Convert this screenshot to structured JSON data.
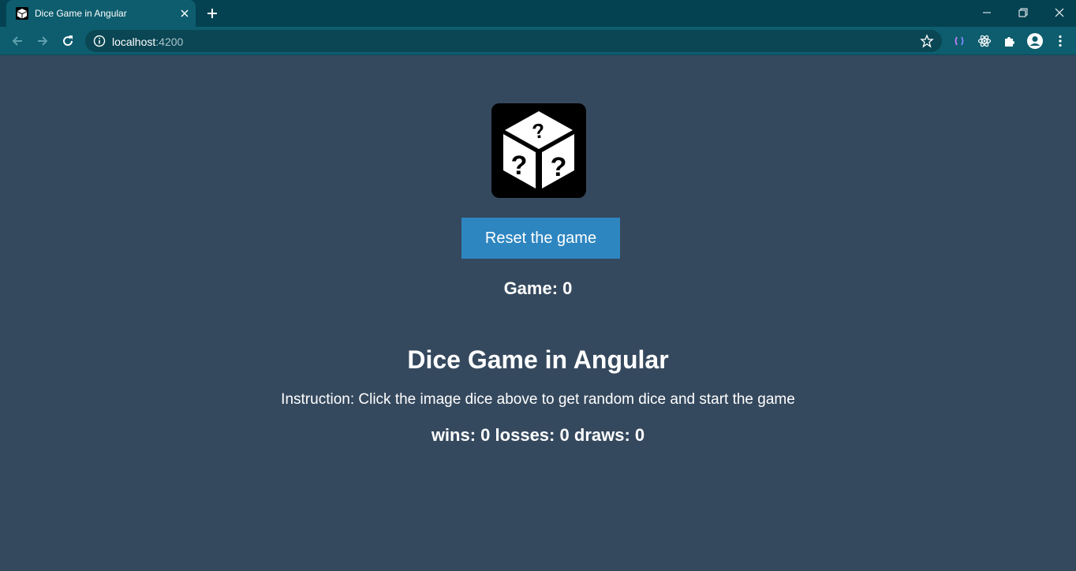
{
  "browser": {
    "tab_title": "Dice Game in Angular",
    "url_host": "localhost",
    "url_port": ":4200",
    "icons": [
      "back-icon",
      "forward-icon",
      "reload-icon",
      "info-icon",
      "star-icon",
      "extension-icon",
      "react-icon",
      "puzzle-icon",
      "profile-icon",
      "menu-icon"
    ]
  },
  "game": {
    "reset_label": "Reset the game",
    "game_label": "Game:",
    "game_count": "0",
    "title": "Dice Game in Angular",
    "instruction": "Instruction: Click the image dice above to get random dice and start the game",
    "wins_label": "wins:",
    "wins": "0",
    "losses_label": "losses:",
    "losses": "0",
    "draws_label": "draws:",
    "draws": "0"
  },
  "colors": {
    "page_bg": "#35495e",
    "button_bg": "#2e86c1",
    "chrome_bg": "#044252",
    "toolbar_bg": "#0d5d6e"
  }
}
